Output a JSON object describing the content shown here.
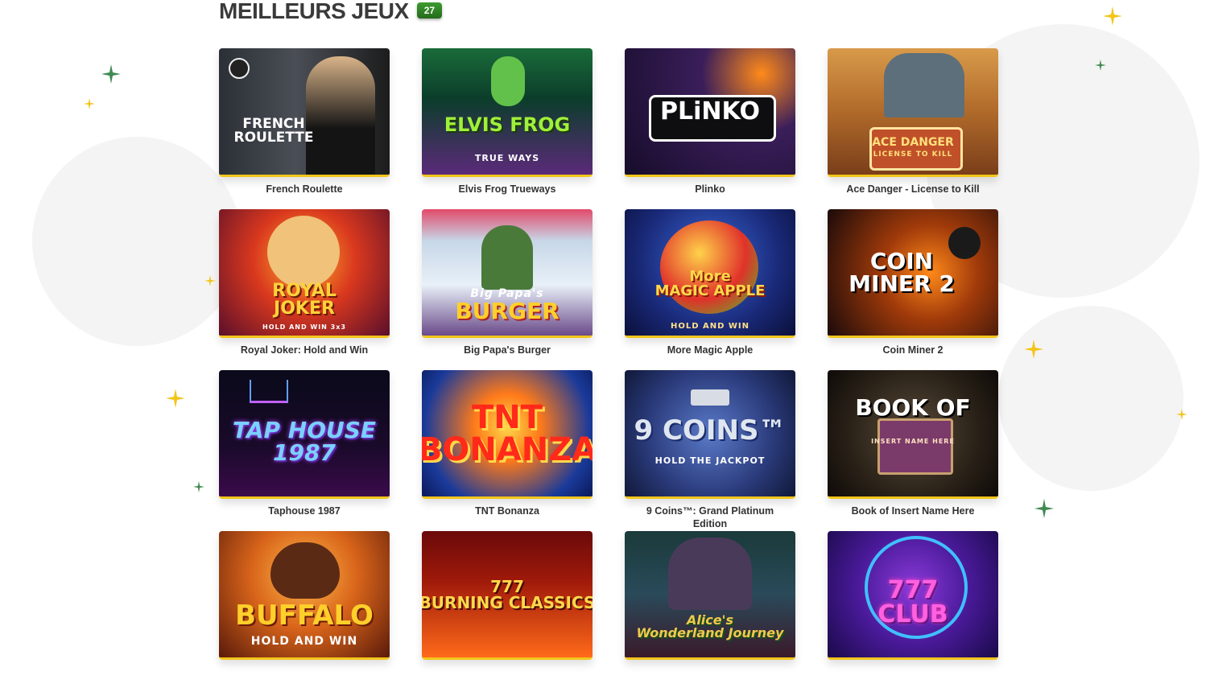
{
  "section": {
    "title": "MEILLEURS JEUX",
    "count": "27"
  },
  "colors": {
    "accent_yellow": "#f2c51a",
    "badge_green": "#2f8a24",
    "title": "#3a3a3a"
  },
  "games": [
    {
      "name": "French Roulette",
      "art": "FRENCH\nROULETTE",
      "sub": ""
    },
    {
      "name": "Elvis Frog Trueways",
      "art": "ELVIS FROG",
      "sub": "TRUE WAYS"
    },
    {
      "name": "Plinko",
      "art": "PLiNKO",
      "sub": ""
    },
    {
      "name": "Ace Danger - License to Kill",
      "art": "ACE DANGER",
      "sub": "LICENSE TO KILL"
    },
    {
      "name": "Royal Joker: Hold and Win",
      "art": "ROYAL\nJOKER",
      "sub": "HOLD AND WIN 3x3"
    },
    {
      "name": "Big Papa's Burger",
      "art": "BURGER",
      "sub": "Big Papa's"
    },
    {
      "name": "More Magic Apple",
      "art": "More\nMAGIC APPLE",
      "sub": "HOLD AND WIN"
    },
    {
      "name": "Coin Miner 2",
      "art": "COIN\nMINER 2",
      "sub": ""
    },
    {
      "name": "Taphouse 1987",
      "art": "TAP HOUSE\n1987",
      "sub": ""
    },
    {
      "name": "TNT Bonanza",
      "art": "TNT\nBONANZA",
      "sub": ""
    },
    {
      "name": "9 Coins™: Grand Platinum Edition",
      "art": "9 COINS™",
      "sub": "HOLD THE JACKPOT"
    },
    {
      "name": "Book of Insert Name Here",
      "art": "BOOK OF",
      "sub": "INSERT NAME HERE"
    },
    {
      "name": "",
      "art": "BUFFALO",
      "sub": "HOLD AND WIN"
    },
    {
      "name": "",
      "art": "777\nBURNING CLASSICS",
      "sub": ""
    },
    {
      "name": "",
      "art": "Alice's\nWonderland Journey",
      "sub": ""
    },
    {
      "name": "",
      "art": "777\nCLUB",
      "sub": ""
    }
  ]
}
